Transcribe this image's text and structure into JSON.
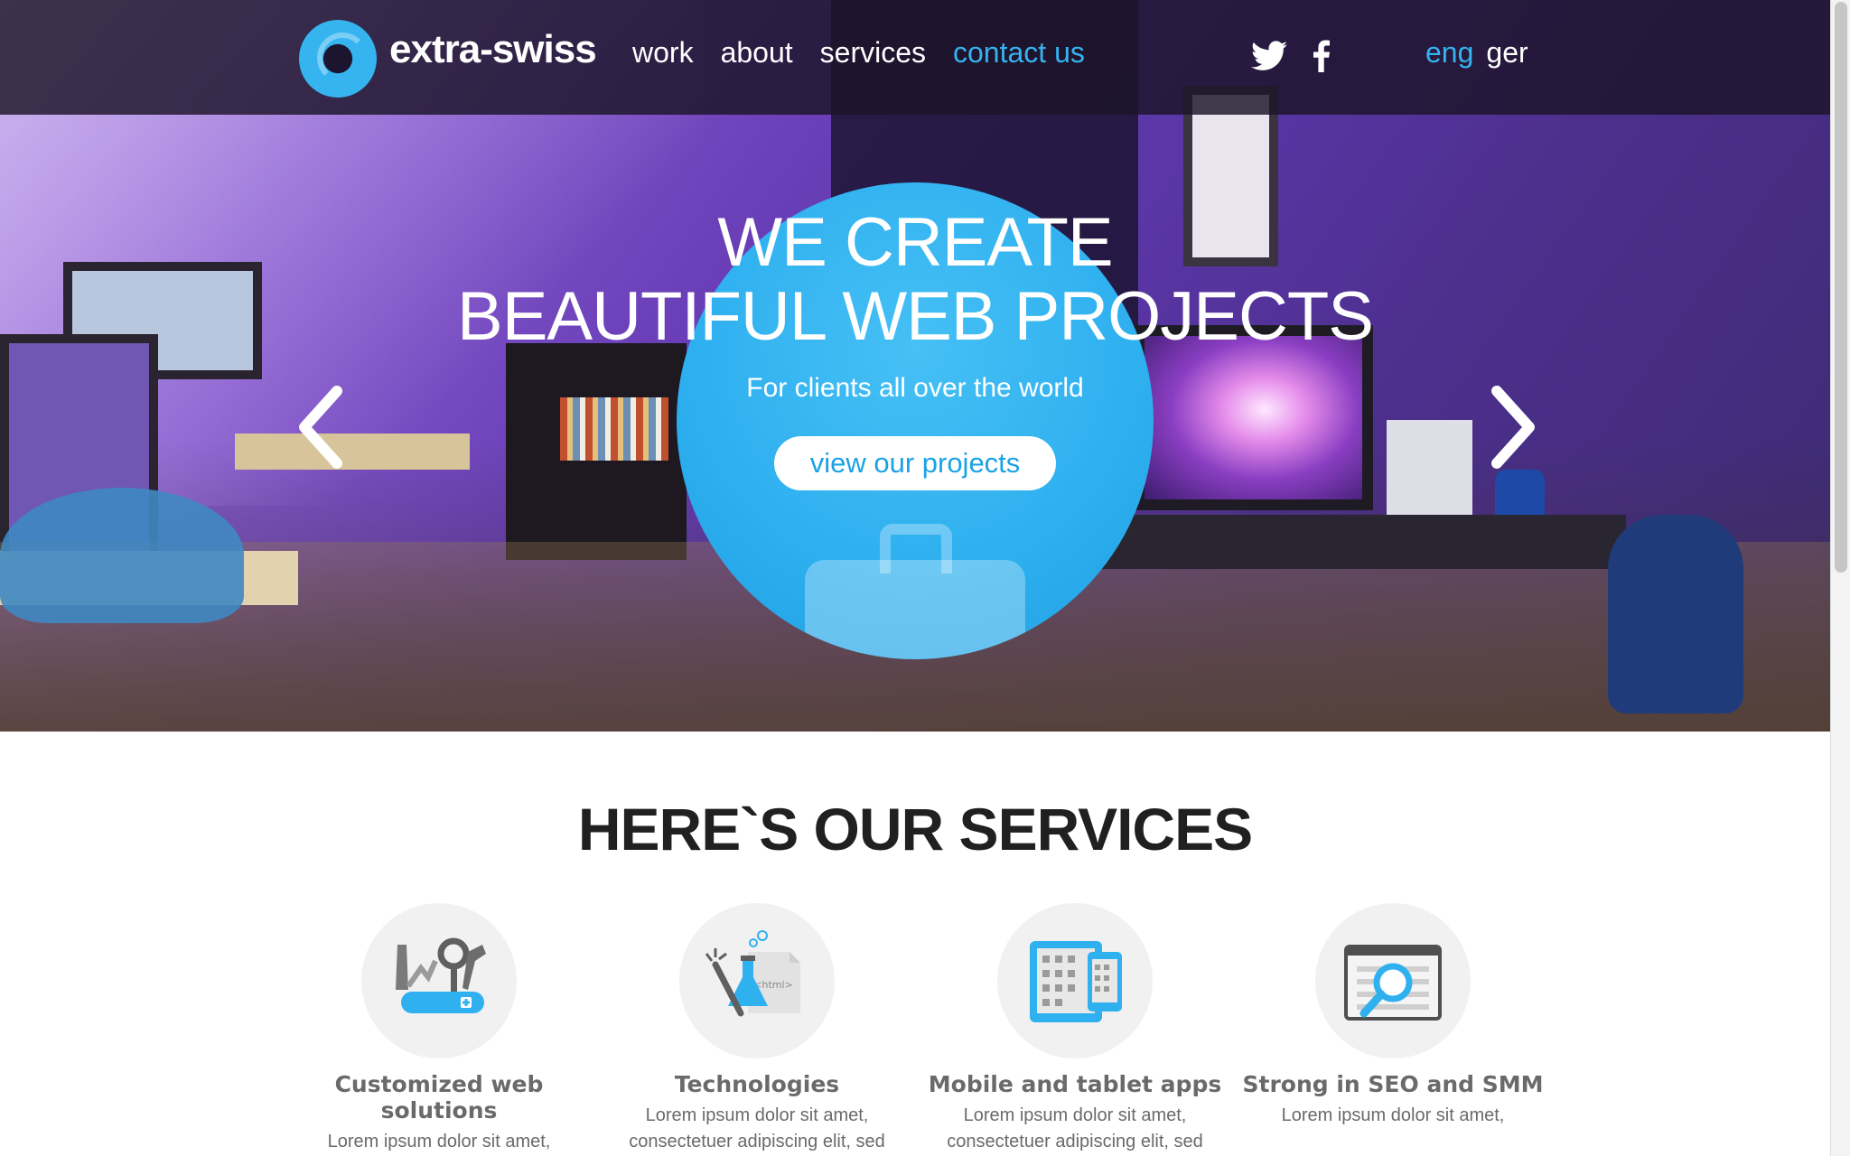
{
  "brand": {
    "name": "extra-swiss"
  },
  "nav": {
    "items": [
      "work",
      "about",
      "services",
      "contact us"
    ],
    "active": "contact us"
  },
  "social": {
    "icons": [
      "twitter-icon",
      "facebook-icon"
    ]
  },
  "lang": {
    "items": [
      "eng",
      "ger"
    ],
    "active": "eng"
  },
  "hero": {
    "headline_line1": "WE CREATE",
    "headline_line2": "BEAUTIFUL WEB PROJECTS",
    "subtitle": "For clients all over the world",
    "cta_label": "view our projects",
    "prev_icon": "chevron-left-icon",
    "next_icon": "chevron-right-icon"
  },
  "services": {
    "title": "HERE`S OUR SERVICES",
    "items": [
      {
        "title": "Customized web solutions",
        "text": "Lorem ipsum dolor sit amet,",
        "icon": "swiss-knife-icon"
      },
      {
        "title": "Technologies",
        "text": "Lorem ipsum dolor sit amet, consectetuer adipiscing elit, sed",
        "icon": "html-lab-icon",
        "icon_text": "<html>"
      },
      {
        "title": "Mobile and tablet apps",
        "text": "Lorem ipsum dolor sit amet, consectetuer adipiscing elit, sed",
        "icon": "tablet-phone-icon"
      },
      {
        "title": "Strong in SEO and SMM",
        "text": "Lorem ipsum dolor sit amet,",
        "icon": "browser-search-icon"
      }
    ]
  },
  "colors": {
    "accent": "#35b3ef",
    "nav_bg": "#1c1428",
    "text_dark": "#202020",
    "text_gray": "#6a6a6a"
  }
}
